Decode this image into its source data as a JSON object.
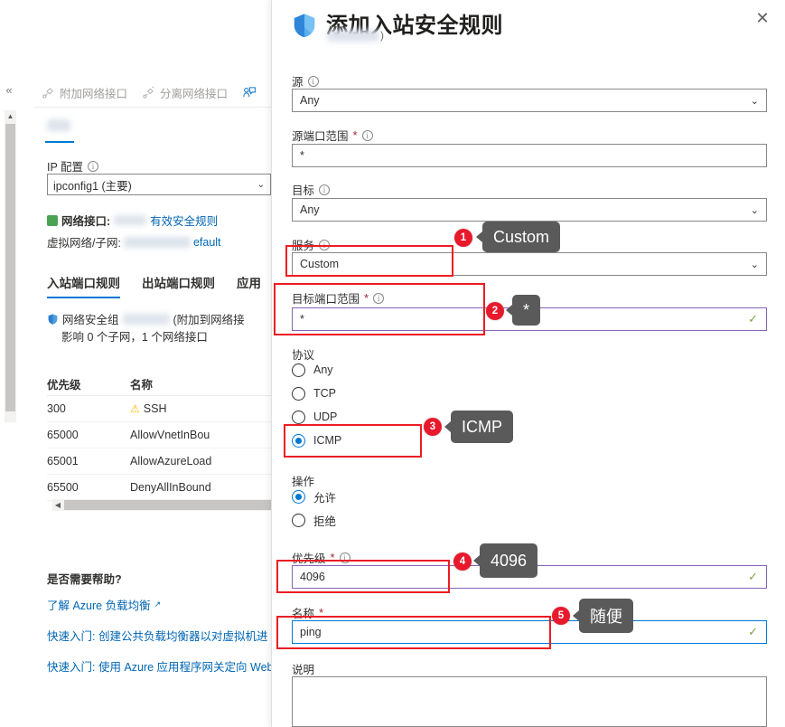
{
  "background_blade": {
    "commandbar": [
      {
        "label": "附加网络接口",
        "icon": "attach-nic-icon"
      },
      {
        "label": "分离网络接口",
        "icon": "detach-nic-icon"
      },
      {
        "label": "",
        "icon": "user-feedback-icon"
      }
    ],
    "ip_config": {
      "label": "IP 配置",
      "value": "ipconfig1 (主要)"
    },
    "nic": {
      "label": "网络接口:",
      "effective_rules_link": "有效安全规则"
    },
    "vnet": {
      "label": "虚拟网络/子网:",
      "value_suffix": "efault"
    },
    "tabs": [
      {
        "label": "入站端口规则",
        "active": true
      },
      {
        "label": "出站端口规则",
        "active": false
      },
      {
        "label": "应用",
        "active": false
      }
    ],
    "nsg": {
      "prefix": "网络安全组",
      "suffix": "(附加到网络接",
      "line2": "影响 0 个子网，1 个网络接口"
    },
    "table": {
      "headers": [
        "优先级",
        "名称"
      ],
      "rows": [
        {
          "priority": "300",
          "name": "SSH",
          "warning": true
        },
        {
          "priority": "65000",
          "name": "AllowVnetInBou",
          "warning": false
        },
        {
          "priority": "65001",
          "name": "AllowAzureLoad",
          "warning": false
        },
        {
          "priority": "65500",
          "name": "DenyAllInBound",
          "warning": false
        }
      ]
    },
    "help": {
      "title": "是否需要帮助?",
      "links": [
        "了解 Azure 负载均衡",
        "快速入门: 创建公共负载均衡器以对虚拟机进",
        "快速入门: 使用 Azure 应用程序网关定向 Web"
      ]
    }
  },
  "panel": {
    "title": "添加入站安全规则",
    "subtitle_suffix": ")",
    "close_label": "✕",
    "fields": {
      "source": {
        "label": "源",
        "value": "Any"
      },
      "source_port_ranges": {
        "label": "源端口范围",
        "required": true,
        "value": "*"
      },
      "destination": {
        "label": "目标",
        "value": "Any"
      },
      "service": {
        "label": "服务",
        "value": "Custom"
      },
      "destination_port_ranges": {
        "label": "目标端口范围",
        "required": true,
        "value": "*"
      },
      "protocol": {
        "label": "协议",
        "options": [
          "Any",
          "TCP",
          "UDP",
          "ICMP"
        ],
        "selected": "ICMP"
      },
      "action": {
        "label": "操作",
        "options": [
          "允许",
          "拒绝"
        ],
        "selected": "允许"
      },
      "priority": {
        "label": "优先级",
        "required": true,
        "value": "4096"
      },
      "name": {
        "label": "名称",
        "required": true,
        "value": "ping"
      },
      "description": {
        "label": "说明",
        "value": ""
      }
    }
  },
  "annotations": [
    {
      "number": "1",
      "tooltip": "Custom"
    },
    {
      "number": "2",
      "tooltip": "*"
    },
    {
      "number": "3",
      "tooltip": "ICMP"
    },
    {
      "number": "4",
      "tooltip": "4096"
    },
    {
      "number": "5",
      "tooltip": "随便"
    }
  ],
  "colors": {
    "accent_blue": "#0078d4",
    "annotation_red": "#ec1c24",
    "badge_red": "#e8192c",
    "tooltip_gray": "#5a5a5a",
    "focus_purple": "#8764b8",
    "valid_green": "#7ba23f",
    "warning_amber": "#ffb900"
  }
}
